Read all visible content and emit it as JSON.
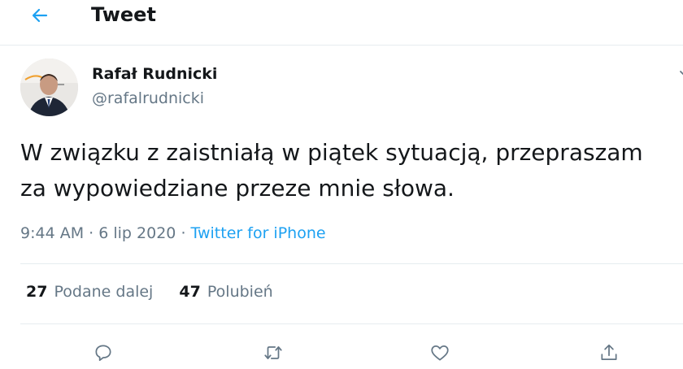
{
  "header": {
    "title": "Tweet",
    "back_icon": "arrow-left-icon",
    "accent_color": "#1da1f2"
  },
  "author": {
    "name": "Rafał Rudnicki",
    "handle": "@rafalrudnicki"
  },
  "tweet": {
    "text": "W związku z zaistniałą w piątek sytuacją, przepraszam za wypowiedziane przeze mnie słowa.",
    "time": "9:44 AM",
    "separator": "·",
    "date": "6 lip 2020",
    "source": "Twitter for iPhone"
  },
  "stats": {
    "retweets_count": "27",
    "retweets_label": "Podane dalej",
    "likes_count": "47",
    "likes_label": "Polubień"
  },
  "actions": [
    "reply-icon",
    "retweet-icon",
    "like-icon",
    "share-icon"
  ],
  "colors": {
    "text_primary": "#14171a",
    "text_secondary": "#657786",
    "link": "#1da1f2",
    "divider": "#e6ecf0"
  }
}
